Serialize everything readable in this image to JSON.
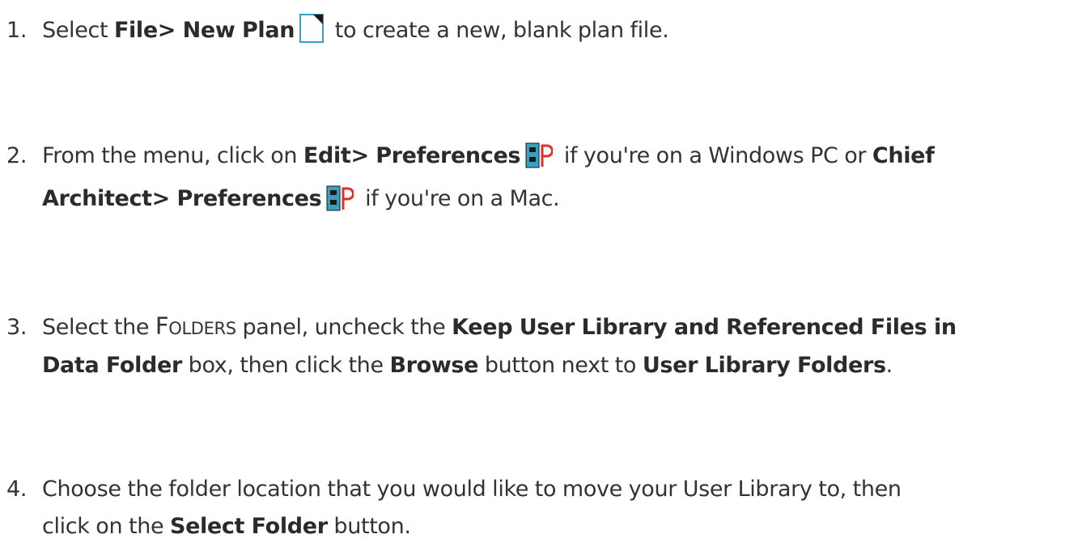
{
  "steps": [
    {
      "number": "1.",
      "text_a": "Select ",
      "bold_a": "File> New Plan",
      "icon_a": "new-plan-icon",
      "text_b": " to create a new, blank plan file."
    },
    {
      "number": "2.",
      "text_a": "From the menu, click on ",
      "bold_a": "Edit> Preferences",
      "icon_a": "preferences-icon",
      "text_b": " if you're on a Windows PC or ",
      "bold_b": "Chief",
      "bold_c": "Architect> Preferences",
      "icon_b": "preferences-icon",
      "text_c": " if you're on a Mac."
    },
    {
      "number": "3.",
      "text_a": "Select the ",
      "panel_first": "F",
      "panel_rest": "OLDERS",
      "text_b": " panel, uncheck the ",
      "bold_a": "Keep User Library and Referenced Files in",
      "bold_b": "Data Folder",
      "text_c": " box, then click the ",
      "bold_c": "Browse",
      "text_d": " button next to ",
      "bold_d": "User Library Folders",
      "text_e": "."
    },
    {
      "number": "4.",
      "text_a": "Choose the folder location that you would like to move your User Library to, then",
      "text_b": "click on the ",
      "bold_a": "Select Folder",
      "text_c": " button."
    }
  ],
  "colors": {
    "text": "#333333",
    "icon_teal": "#3a9fc0",
    "icon_dark": "#1a1a1a",
    "icon_red": "#e0302a"
  }
}
